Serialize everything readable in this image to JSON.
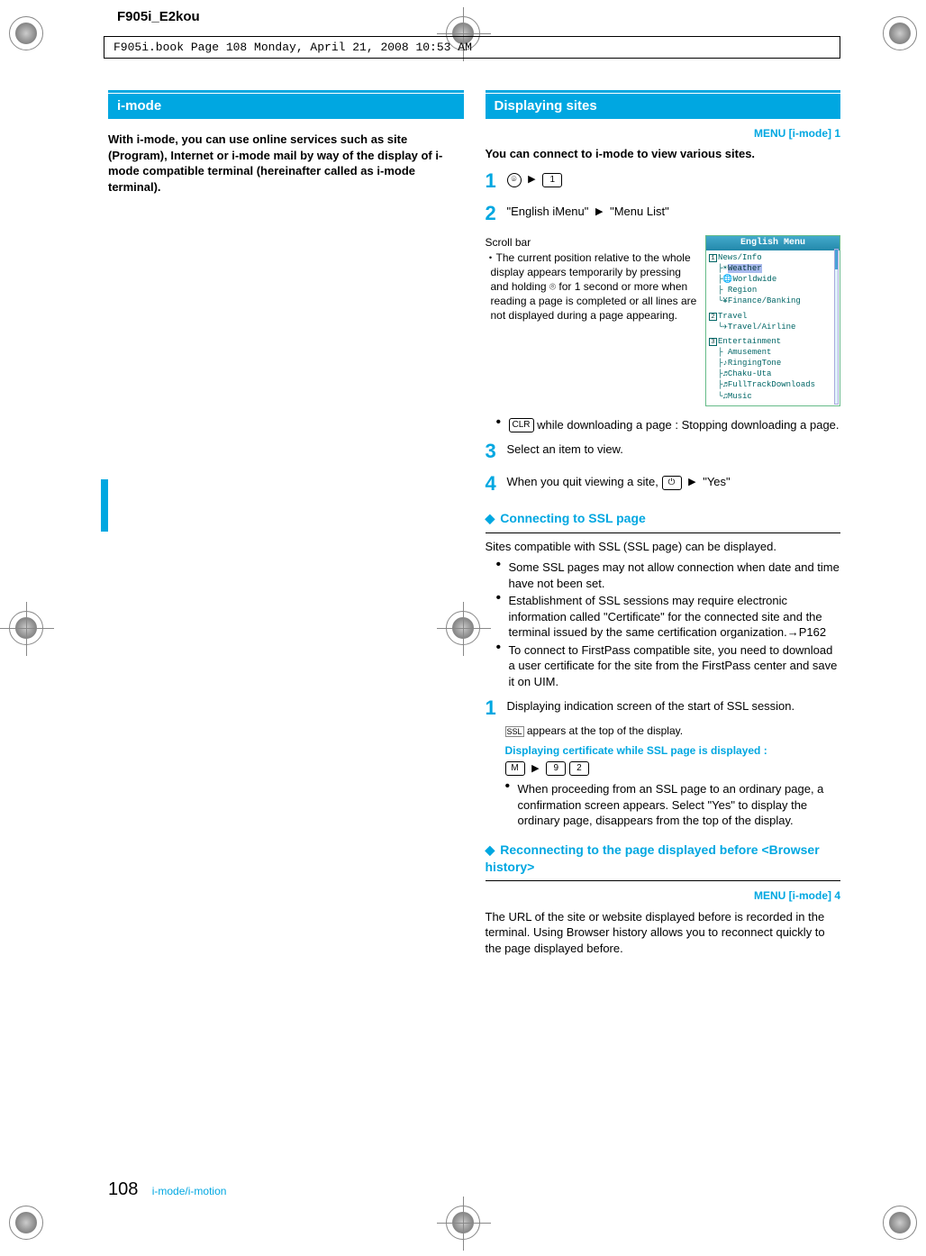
{
  "header": {
    "code": "F905i_E2kou"
  },
  "book_meta": "F905i.book  Page 108  Monday, April 21, 2008  10:53 AM",
  "left": {
    "section_title": "i-mode",
    "intro": "With i-mode, you can use online services such as site (Program), Internet or i-mode mail by way of the display of i-mode compatible terminal (hereinafter called as i-mode terminal)."
  },
  "right": {
    "section_title": "Displaying sites",
    "menu_path": "MENU [i-mode] 1",
    "lead": "You can connect to i-mode to view various sites.",
    "step1": {
      "num": "1",
      "key_a": "⌾",
      "key_b": "1"
    },
    "step2": {
      "num": "2",
      "a": "\"English iMenu\"",
      "b": "\"Menu List\""
    },
    "scrollbar_label": "Scroll bar",
    "scrollbar_desc": "The current position relative to the whole display appears temporarily by pressing and holding ⌾ for 1 second or more when reading a page is completed or all lines are not displayed during a page appearing.",
    "phone": {
      "title": "English Menu",
      "cat1": "News/Info",
      "cat1_items": [
        "Weather",
        "Worldwide",
        "Region",
        "Finance/Banking"
      ],
      "cat2": "Travel",
      "cat2_items": [
        "Travel/Airline"
      ],
      "cat3": "Entertainment",
      "cat3_items": [
        "Amusement",
        "RingingTone",
        "Chaku-Uta",
        "FullTrackDownloads",
        "Music"
      ]
    },
    "stop_dl": "while downloading a page : Stopping downloading a page.",
    "stop_key": "CLR",
    "step3": {
      "num": "3",
      "text": "Select an item to view."
    },
    "step4": {
      "num": "4",
      "a": "When you quit viewing a site,",
      "key": "⏻",
      "b": "\"Yes\""
    },
    "ssl_head": "Connecting to SSL page",
    "ssl_intro": "Sites compatible with SSL (SSL page) can be displayed.",
    "ssl_b1": "Some SSL pages may not allow connection when date and time have not been set.",
    "ssl_b2": "Establishment of SSL sessions may require electronic information called \"Certificate\" for the connected site and the terminal issued by the same certification organization.→P162",
    "ssl_b3": "To connect to FirstPass compatible site, you need to download a user certificate for the site from the FirstPass center and save it on UIM.",
    "ssl_step1_num": "1",
    "ssl_step1": "Displaying indication screen of the start of SSL session.",
    "ssl_appears": "appears at the top of the display.",
    "ssl_icon": "SSL",
    "ssl_cert": "Displaying certificate while SSL page is displayed :",
    "ssl_cert_key0": "M",
    "ssl_cert_key1": "9",
    "ssl_cert_key2": "2",
    "ssl_proceed": "When proceeding from an SSL page to an ordinary page, a confirmation screen appears. Select \"Yes\" to display the ordinary page,      disappears from the top of the display.",
    "reconnect_head": "Reconnecting to the page displayed before <Browser history>",
    "reconnect_menu": "MENU [i-mode] 4",
    "reconnect_body": "The URL of the site or website displayed before is recorded in the terminal. Using Browser history allows you to reconnect quickly to the page displayed before."
  },
  "footer": {
    "page": "108",
    "section": "i-mode/i-motion"
  }
}
